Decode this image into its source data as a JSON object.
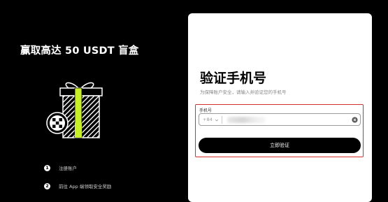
{
  "promo": {
    "title": "赢取高达 50 USDT 盲盒",
    "steps": [
      {
        "number": "1",
        "label": "注册账户"
      },
      {
        "number": "2",
        "label": "前往 App 端领取安全奖励"
      }
    ]
  },
  "form": {
    "title": "验证手机号",
    "subtitle": "为保障账户安全，请输入并验证您的手机号",
    "phone_label": "手机号",
    "country_code": "+84",
    "button_label": "立即验证"
  },
  "colors": {
    "highlight": "#d32f2f",
    "accent": "#c8f02a"
  },
  "icons": [
    "gift-icon",
    "logo-badge-icon",
    "chevron-down-icon",
    "clear-icon"
  ]
}
